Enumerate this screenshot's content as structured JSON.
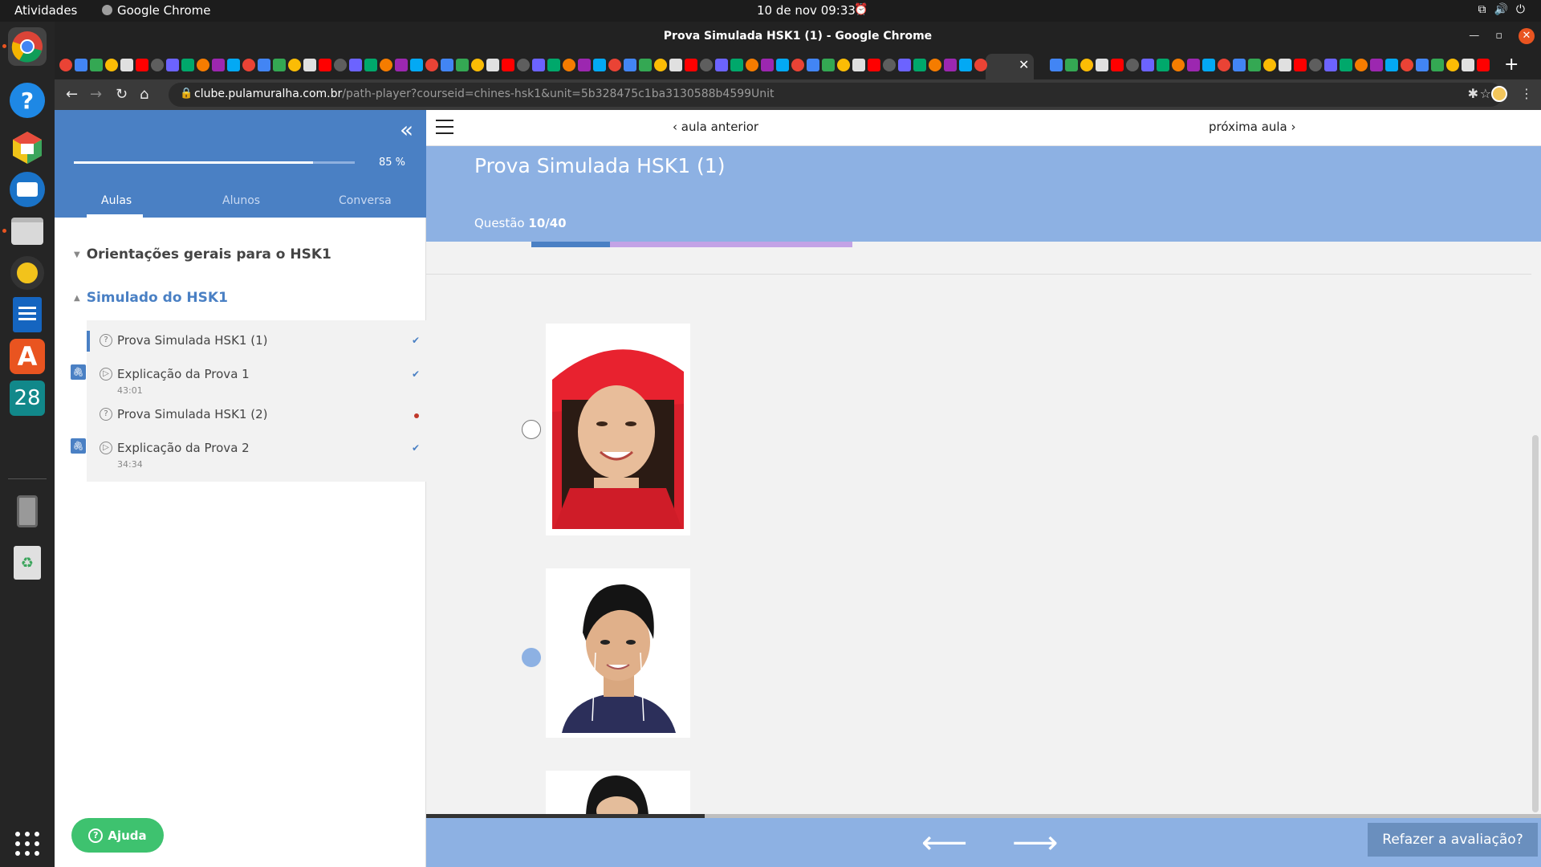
{
  "os": {
    "activities": "Atividades",
    "app_name": "Google Chrome",
    "clock": "10 de nov  09:33"
  },
  "browser": {
    "window_title": "Prova Simulada HSK1 (1) - Google Chrome",
    "url_host": "clube.pulamuralha.com.br",
    "url_path": "/path-player?courseid=chines-hsk1&unit=5b328475c1ba3130588b4599Unit"
  },
  "dock": {
    "calendar_day": "28"
  },
  "sidebar": {
    "progress_label": "85 %",
    "progress_value": 0.85,
    "tabs": [
      "Aulas",
      "Alunos",
      "Conversa"
    ],
    "active_tab": "Aulas",
    "sections": [
      {
        "title": "Orientações gerais para o HSK1",
        "expanded": false
      },
      {
        "title": "Simulado do HSK1",
        "expanded": true
      }
    ],
    "lessons": [
      {
        "title": "Prova Simulada HSK1 (1)",
        "icon": "question-icon",
        "duration": "",
        "status": "done",
        "current": true,
        "attachment": false
      },
      {
        "title": "Explicação da Prova 1",
        "icon": "play-icon",
        "duration": "43:01",
        "status": "done",
        "current": false,
        "attachment": true
      },
      {
        "title": "Prova Simulada HSK1 (2)",
        "icon": "question-icon",
        "duration": "",
        "status": "pending",
        "current": false,
        "attachment": false
      },
      {
        "title": "Explicação da Prova 2",
        "icon": "play-icon",
        "duration": "34:34",
        "status": "done",
        "current": false,
        "attachment": true
      }
    ],
    "help_label": "Ajuda"
  },
  "content": {
    "prev_label": "aula anterior",
    "next_label": "próxima aula",
    "title": "Prova Simulada HSK1 (1)",
    "question_label": "Questão",
    "question_value": "10/40",
    "options": [
      {
        "image": "girl-red-hat-photo",
        "selected": false
      },
      {
        "image": "young-man-photo",
        "selected": true
      },
      {
        "image": "woman-partial-photo",
        "selected": false
      }
    ],
    "retake_label": "Refazer a avaliação?"
  },
  "colors": {
    "accent": "#4a80c4",
    "header_light": "#8db1e3",
    "help_green": "#3ec26f",
    "progress_purple": "#c3a3e6"
  }
}
